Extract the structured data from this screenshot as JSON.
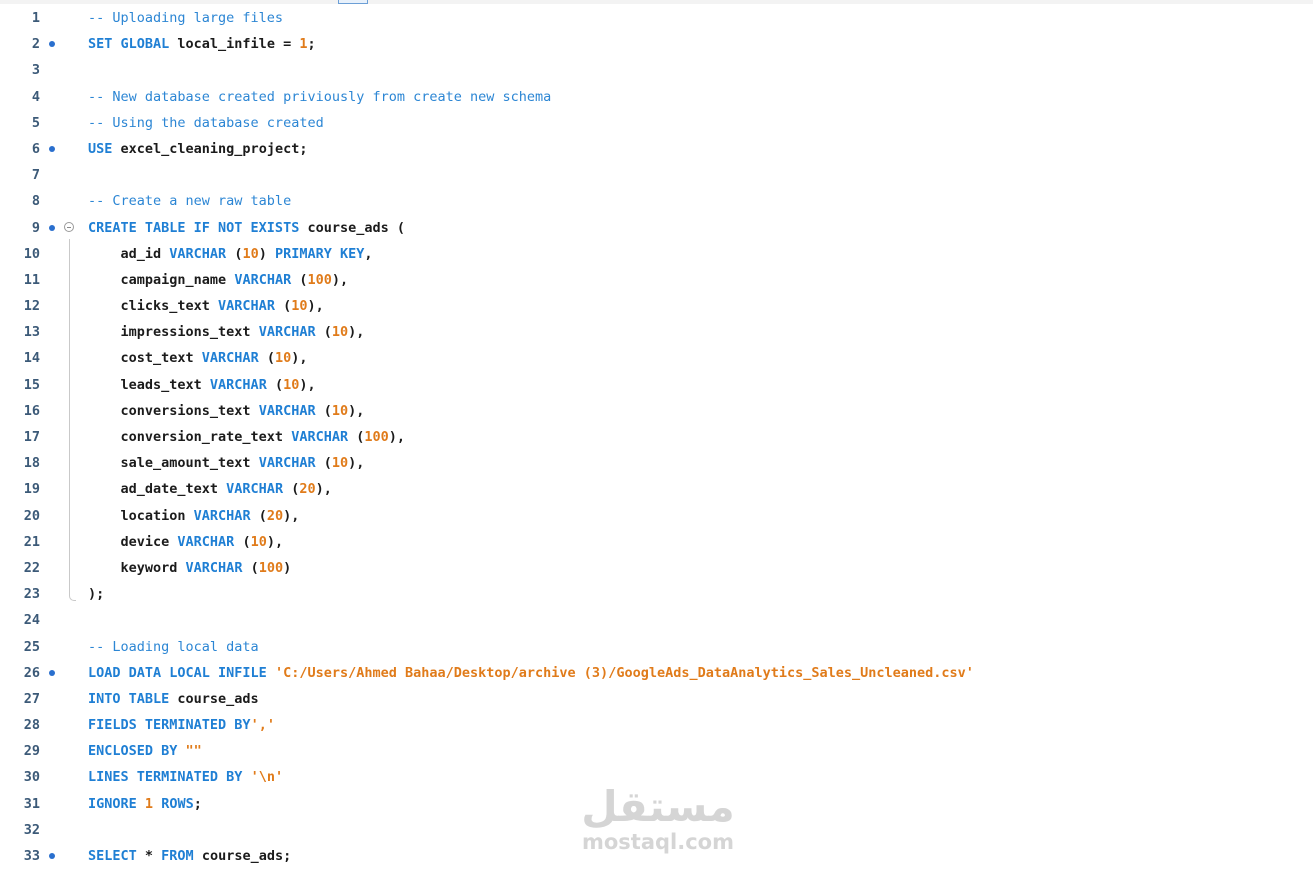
{
  "editor": {
    "lines": [
      {
        "n": "1",
        "bp": false,
        "tokens": [
          {
            "t": "-- Uploading large files",
            "c": "cmt"
          }
        ]
      },
      {
        "n": "2",
        "bp": true,
        "tokens": [
          {
            "t": "SET GLOBAL",
            "c": "kw"
          },
          {
            "t": " local_infile = ",
            "c": "id"
          },
          {
            "t": "1",
            "c": "num"
          },
          {
            "t": ";",
            "c": "id"
          }
        ]
      },
      {
        "n": "3",
        "bp": false,
        "tokens": []
      },
      {
        "n": "4",
        "bp": false,
        "tokens": [
          {
            "t": "-- New database created priviously from create new schema",
            "c": "cmt"
          }
        ]
      },
      {
        "n": "5",
        "bp": false,
        "tokens": [
          {
            "t": "-- Using the database created",
            "c": "cmt"
          }
        ]
      },
      {
        "n": "6",
        "bp": true,
        "tokens": [
          {
            "t": "USE",
            "c": "kw"
          },
          {
            "t": " excel_cleaning_project;",
            "c": "id"
          }
        ]
      },
      {
        "n": "7",
        "bp": false,
        "tokens": []
      },
      {
        "n": "8",
        "bp": false,
        "tokens": [
          {
            "t": "-- Create a new raw table",
            "c": "cmt"
          }
        ]
      },
      {
        "n": "9",
        "bp": true,
        "fold": true,
        "tokens": [
          {
            "t": "CREATE TABLE IF NOT EXISTS",
            "c": "kw"
          },
          {
            "t": " course_ads (",
            "c": "id"
          }
        ]
      },
      {
        "n": "10",
        "bp": false,
        "tokens": [
          {
            "t": "    ad_id ",
            "c": "id"
          },
          {
            "t": "VARCHAR",
            "c": "kw"
          },
          {
            "t": " (",
            "c": "id"
          },
          {
            "t": "10",
            "c": "num"
          },
          {
            "t": ") ",
            "c": "id"
          },
          {
            "t": "PRIMARY KEY",
            "c": "kw"
          },
          {
            "t": ",",
            "c": "id"
          }
        ]
      },
      {
        "n": "11",
        "bp": false,
        "tokens": [
          {
            "t": "    campaign_name ",
            "c": "id"
          },
          {
            "t": "VARCHAR",
            "c": "kw"
          },
          {
            "t": " (",
            "c": "id"
          },
          {
            "t": "100",
            "c": "num"
          },
          {
            "t": "),",
            "c": "id"
          }
        ]
      },
      {
        "n": "12",
        "bp": false,
        "tokens": [
          {
            "t": "    clicks_text ",
            "c": "id"
          },
          {
            "t": "VARCHAR",
            "c": "kw"
          },
          {
            "t": " (",
            "c": "id"
          },
          {
            "t": "10",
            "c": "num"
          },
          {
            "t": "),",
            "c": "id"
          }
        ]
      },
      {
        "n": "13",
        "bp": false,
        "tokens": [
          {
            "t": "    impressions_text ",
            "c": "id"
          },
          {
            "t": "VARCHAR",
            "c": "kw"
          },
          {
            "t": " (",
            "c": "id"
          },
          {
            "t": "10",
            "c": "num"
          },
          {
            "t": "),",
            "c": "id"
          }
        ]
      },
      {
        "n": "14",
        "bp": false,
        "tokens": [
          {
            "t": "    cost_text ",
            "c": "id"
          },
          {
            "t": "VARCHAR",
            "c": "kw"
          },
          {
            "t": " (",
            "c": "id"
          },
          {
            "t": "10",
            "c": "num"
          },
          {
            "t": "),",
            "c": "id"
          }
        ]
      },
      {
        "n": "15",
        "bp": false,
        "tokens": [
          {
            "t": "    leads_text ",
            "c": "id"
          },
          {
            "t": "VARCHAR",
            "c": "kw"
          },
          {
            "t": " (",
            "c": "id"
          },
          {
            "t": "10",
            "c": "num"
          },
          {
            "t": "),",
            "c": "id"
          }
        ]
      },
      {
        "n": "16",
        "bp": false,
        "tokens": [
          {
            "t": "    conversions_text ",
            "c": "id"
          },
          {
            "t": "VARCHAR",
            "c": "kw"
          },
          {
            "t": " (",
            "c": "id"
          },
          {
            "t": "10",
            "c": "num"
          },
          {
            "t": "),",
            "c": "id"
          }
        ]
      },
      {
        "n": "17",
        "bp": false,
        "tokens": [
          {
            "t": "    conversion_rate_text ",
            "c": "id"
          },
          {
            "t": "VARCHAR",
            "c": "kw"
          },
          {
            "t": " (",
            "c": "id"
          },
          {
            "t": "100",
            "c": "num"
          },
          {
            "t": "),",
            "c": "id"
          }
        ]
      },
      {
        "n": "18",
        "bp": false,
        "tokens": [
          {
            "t": "    sale_amount_text ",
            "c": "id"
          },
          {
            "t": "VARCHAR",
            "c": "kw"
          },
          {
            "t": " (",
            "c": "id"
          },
          {
            "t": "10",
            "c": "num"
          },
          {
            "t": "),",
            "c": "id"
          }
        ]
      },
      {
        "n": "19",
        "bp": false,
        "tokens": [
          {
            "t": "    ad_date_text ",
            "c": "id"
          },
          {
            "t": "VARCHAR",
            "c": "kw"
          },
          {
            "t": " (",
            "c": "id"
          },
          {
            "t": "20",
            "c": "num"
          },
          {
            "t": "),",
            "c": "id"
          }
        ]
      },
      {
        "n": "20",
        "bp": false,
        "tokens": [
          {
            "t": "    location ",
            "c": "id"
          },
          {
            "t": "VARCHAR",
            "c": "kw"
          },
          {
            "t": " (",
            "c": "id"
          },
          {
            "t": "20",
            "c": "num"
          },
          {
            "t": "),",
            "c": "id"
          }
        ]
      },
      {
        "n": "21",
        "bp": false,
        "tokens": [
          {
            "t": "    device ",
            "c": "id"
          },
          {
            "t": "VARCHAR",
            "c": "kw"
          },
          {
            "t": " (",
            "c": "id"
          },
          {
            "t": "10",
            "c": "num"
          },
          {
            "t": "),",
            "c": "id"
          }
        ]
      },
      {
        "n": "22",
        "bp": false,
        "tokens": [
          {
            "t": "    keyword ",
            "c": "id"
          },
          {
            "t": "VARCHAR",
            "c": "kw"
          },
          {
            "t": " (",
            "c": "id"
          },
          {
            "t": "100",
            "c": "num"
          },
          {
            "t": ")",
            "c": "id"
          }
        ]
      },
      {
        "n": "23",
        "bp": false,
        "tokens": [
          {
            "t": ");",
            "c": "id"
          }
        ]
      },
      {
        "n": "24",
        "bp": false,
        "tokens": []
      },
      {
        "n": "25",
        "bp": false,
        "tokens": [
          {
            "t": "-- Loading local data",
            "c": "cmt"
          }
        ]
      },
      {
        "n": "26",
        "bp": true,
        "tokens": [
          {
            "t": "LOAD DATA LOCAL INFILE",
            "c": "kw"
          },
          {
            "t": " ",
            "c": "id"
          },
          {
            "t": "'C:/Users/Ahmed Bahaa/Desktop/archive (3)/GoogleAds_DataAnalytics_Sales_Uncleaned.csv'",
            "c": "str"
          }
        ]
      },
      {
        "n": "27",
        "bp": false,
        "tokens": [
          {
            "t": "INTO TABLE",
            "c": "kw"
          },
          {
            "t": " course_ads",
            "c": "id"
          }
        ]
      },
      {
        "n": "28",
        "bp": false,
        "tokens": [
          {
            "t": "FIELDS TERMINATED BY",
            "c": "kw"
          },
          {
            "t": "','",
            "c": "str"
          }
        ]
      },
      {
        "n": "29",
        "bp": false,
        "tokens": [
          {
            "t": "ENCLOSED BY",
            "c": "kw"
          },
          {
            "t": " ",
            "c": "id"
          },
          {
            "t": "\"\"",
            "c": "str"
          }
        ]
      },
      {
        "n": "30",
        "bp": false,
        "tokens": [
          {
            "t": "LINES TERMINATED BY",
            "c": "kw"
          },
          {
            "t": " ",
            "c": "id"
          },
          {
            "t": "'\\n'",
            "c": "str"
          }
        ]
      },
      {
        "n": "31",
        "bp": false,
        "tokens": [
          {
            "t": "IGNORE",
            "c": "kw"
          },
          {
            "t": " ",
            "c": "id"
          },
          {
            "t": "1",
            "c": "num"
          },
          {
            "t": " ",
            "c": "id"
          },
          {
            "t": "ROWS",
            "c": "kw"
          },
          {
            "t": ";",
            "c": "id"
          }
        ]
      },
      {
        "n": "32",
        "bp": false,
        "tokens": []
      },
      {
        "n": "33",
        "bp": true,
        "tokens": [
          {
            "t": "SELECT",
            "c": "kw"
          },
          {
            "t": " * ",
            "c": "id"
          },
          {
            "t": "FROM",
            "c": "kw"
          },
          {
            "t": " course_ads;",
            "c": "id"
          }
        ]
      }
    ]
  },
  "watermark": {
    "arabic": "مستقل",
    "latin": "mostaql.com"
  },
  "colors": {
    "keyword": "#1f7fd4",
    "number": "#e07b1a",
    "string": "#e07b1a",
    "comment": "#2c86d4",
    "breakpoint": "#2a6fce"
  }
}
